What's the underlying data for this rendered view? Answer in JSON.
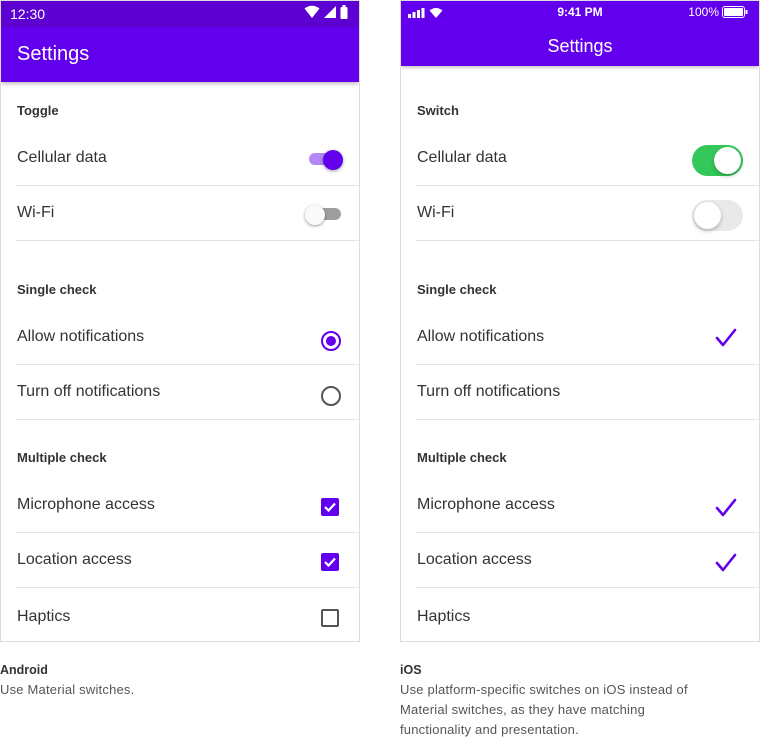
{
  "colors": {
    "primary": "#6200ee",
    "status_bar": "#5d00d2",
    "ios_switch_on": "#34c759"
  },
  "android": {
    "status_bar": {
      "time": "12:30",
      "icons": [
        "wifi-icon",
        "signal-icon",
        "battery-icon"
      ]
    },
    "app_bar": {
      "title": "Settings"
    },
    "sections": [
      {
        "title": "Toggle",
        "items": [
          {
            "label": "Cellular data",
            "control": "switch",
            "checked": true
          },
          {
            "label": "Wi-Fi",
            "control": "switch",
            "checked": false
          }
        ]
      },
      {
        "title": "Single check",
        "items": [
          {
            "label": "Allow notifications",
            "control": "radio",
            "checked": true
          },
          {
            "label": "Turn off notifications",
            "control": "radio",
            "checked": false
          }
        ]
      },
      {
        "title": "Multiple check",
        "items": [
          {
            "label": "Microphone access",
            "control": "checkbox",
            "checked": true
          },
          {
            "label": "Location access",
            "control": "checkbox",
            "checked": true
          },
          {
            "label": "Haptics",
            "control": "checkbox",
            "checked": false
          }
        ]
      }
    ],
    "caption": {
      "title": "Android",
      "text": "Use Material switches."
    }
  },
  "ios": {
    "status_bar": {
      "time": "9:41 PM",
      "battery": "100%",
      "icons": [
        "signal-icon",
        "wifi-icon",
        "battery-icon"
      ]
    },
    "nav_bar": {
      "title": "Settings"
    },
    "sections": [
      {
        "title": "Switch",
        "items": [
          {
            "label": "Cellular data",
            "control": "switch",
            "checked": true
          },
          {
            "label": "Wi-Fi",
            "control": "switch",
            "checked": false
          }
        ]
      },
      {
        "title": "Single check",
        "items": [
          {
            "label": "Allow notifications",
            "control": "checkmark",
            "checked": true
          },
          {
            "label": "Turn off notifications",
            "control": "checkmark",
            "checked": false
          }
        ]
      },
      {
        "title": "Multiple check",
        "items": [
          {
            "label": "Microphone access",
            "control": "checkmark",
            "checked": true
          },
          {
            "label": "Location access",
            "control": "checkmark",
            "checked": true
          },
          {
            "label": "Haptics",
            "control": "checkmark",
            "checked": false
          }
        ]
      }
    ],
    "caption": {
      "title": "iOS",
      "text_lines": [
        "Use platform-specific switches on iOS instead of",
        "Material switches, as they have matching",
        "functionality and presentation."
      ]
    }
  }
}
